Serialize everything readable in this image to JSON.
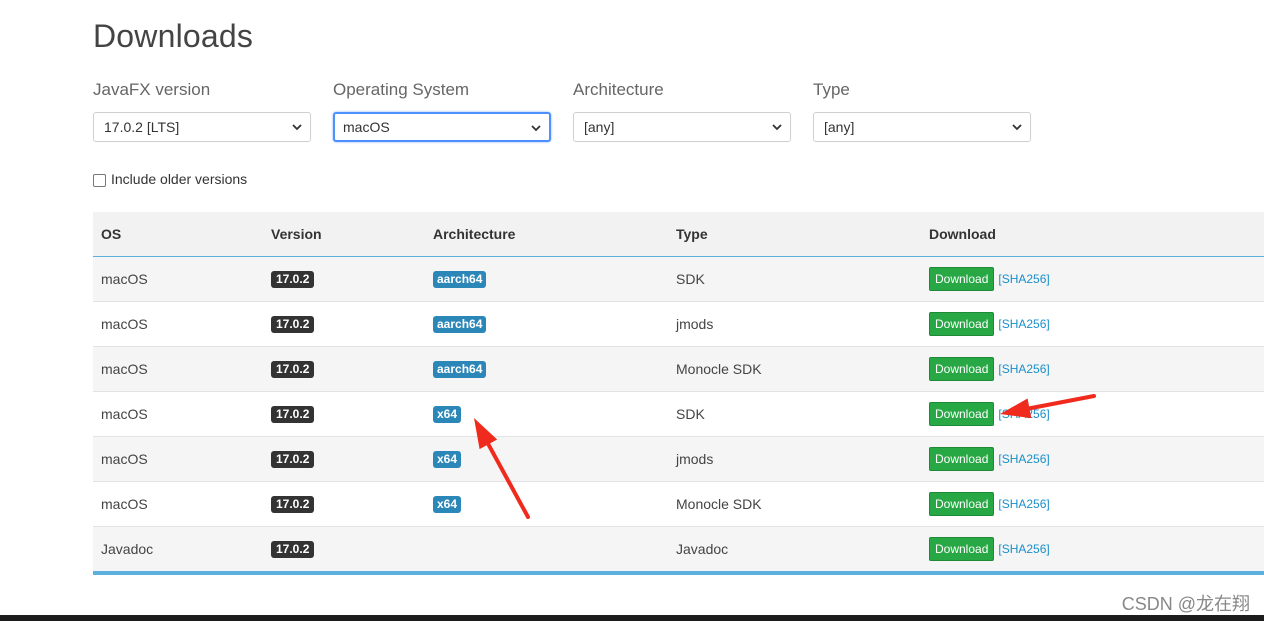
{
  "page": {
    "title": "Downloads"
  },
  "filters": [
    {
      "label": "JavaFX version",
      "value": "17.0.2 [LTS]",
      "focused": false
    },
    {
      "label": "Operating System",
      "value": "macOS",
      "focused": true
    },
    {
      "label": "Architecture",
      "value": "[any]",
      "focused": false
    },
    {
      "label": "Type",
      "value": "[any]",
      "focused": false
    }
  ],
  "checkbox": {
    "label": "Include older versions",
    "checked": false
  },
  "table": {
    "headers": [
      "OS",
      "Version",
      "Architecture",
      "Type",
      "Download"
    ],
    "rows": [
      {
        "os": "macOS",
        "version": "17.0.2",
        "arch": "aarch64",
        "type": "SDK",
        "download": "Download",
        "sha": "[SHA256]"
      },
      {
        "os": "macOS",
        "version": "17.0.2",
        "arch": "aarch64",
        "type": "jmods",
        "download": "Download",
        "sha": "[SHA256]"
      },
      {
        "os": "macOS",
        "version": "17.0.2",
        "arch": "aarch64",
        "type": "Monocle SDK",
        "download": "Download",
        "sha": "[SHA256]"
      },
      {
        "os": "macOS",
        "version": "17.0.2",
        "arch": "x64",
        "type": "SDK",
        "download": "Download",
        "sha": "[SHA256]"
      },
      {
        "os": "macOS",
        "version": "17.0.2",
        "arch": "x64",
        "type": "jmods",
        "download": "Download",
        "sha": "[SHA256]"
      },
      {
        "os": "macOS",
        "version": "17.0.2",
        "arch": "x64",
        "type": "Monocle SDK",
        "download": "Download",
        "sha": "[SHA256]"
      },
      {
        "os": "Javadoc",
        "version": "17.0.2",
        "arch": "",
        "type": "Javadoc",
        "download": "Download",
        "sha": "[SHA256]"
      }
    ]
  },
  "annotations": {
    "arrow_color": "#f02a1c"
  },
  "watermark": "CSDN @龙在翔",
  "colors": {
    "accent": "#5bb0de",
    "download_green": "#28a745",
    "arch_badge": "#2b87b8",
    "version_badge": "#333333"
  }
}
